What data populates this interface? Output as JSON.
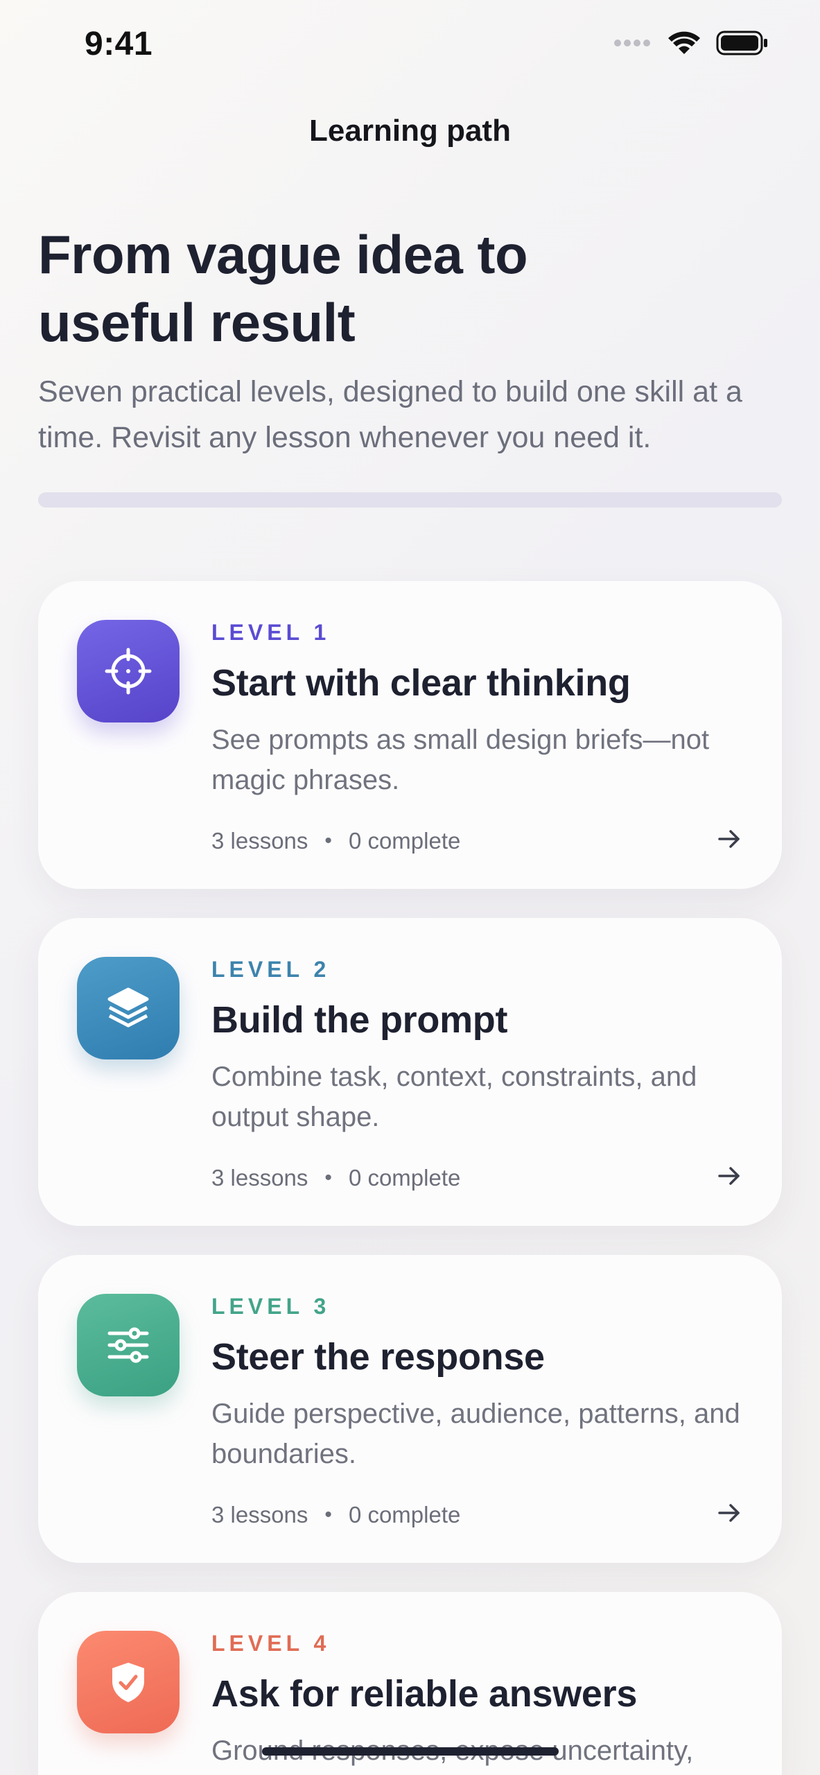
{
  "status_bar": {
    "time": "9:41"
  },
  "nav": {
    "title": "Learning path"
  },
  "hero": {
    "title": "From vague idea to useful result",
    "subtitle": "Seven practical levels, designed to build one skill at a time. Revisit any lesson whenever you need it.",
    "progress_fraction": 0
  },
  "levels": [
    {
      "level_label": "LEVEL 1",
      "title": "Start with clear thinking",
      "description": "See prompts as small design briefs—not magic phrases.",
      "lessons": "3 lessons",
      "complete": "0 complete",
      "icon": "target-icon",
      "accent": "#5a4bd3",
      "icon_gradient": [
        "#7466e6",
        "#5643c9"
      ]
    },
    {
      "level_label": "LEVEL 2",
      "title": "Build the prompt",
      "description": "Combine task, context, constraints, and output shape.",
      "lessons": "3 lessons",
      "complete": "0 complete",
      "icon": "layers-icon",
      "accent": "#3d83ad",
      "icon_gradient": [
        "#4e9cc8",
        "#2f7db0"
      ]
    },
    {
      "level_label": "LEVEL 3",
      "title": "Steer the response",
      "description": "Guide perspective, audience, patterns, and boundaries.",
      "lessons": "3 lessons",
      "complete": "0 complete",
      "icon": "sliders-icon",
      "accent": "#43a489",
      "icon_gradient": [
        "#5bbc9c",
        "#3aa182"
      ]
    },
    {
      "level_label": "LEVEL 4",
      "title": "Ask for reliable answers",
      "description": "Ground responses, expose uncertainty,",
      "lessons": "",
      "complete": "",
      "icon": "shield-check-icon",
      "accent": "#e06c54",
      "icon_gradient": [
        "#fb8a70",
        "#ef6a55"
      ]
    }
  ]
}
